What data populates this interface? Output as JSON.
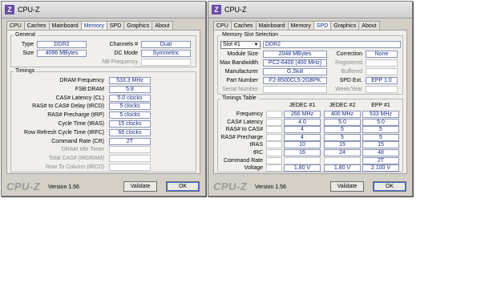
{
  "left": {
    "title": "CPU-Z",
    "tabs": [
      "CPU",
      "Caches",
      "Mainboard",
      "Memory",
      "SPD",
      "Graphics",
      "About"
    ],
    "general": {
      "title": "General",
      "type_label": "Type",
      "type_value": "DDR2",
      "size_label": "Size",
      "size_value": "4096 MBytes",
      "channels_label": "Channels #",
      "channels_value": "Dual",
      "dcmode_label": "DC Mode",
      "dcmode_value": "Symmetric",
      "nbfreq_label": "NB Frequency"
    },
    "timings": {
      "title": "Timings",
      "rows": [
        {
          "label": "DRAM Frequency",
          "value": "533.3 MHz"
        },
        {
          "label": "FSB:DRAM",
          "value": "5:8"
        },
        {
          "label": "CAS# Latency (CL)",
          "value": "5.0 clocks"
        },
        {
          "label": "RAS# to CAS# Delay (tRCD)",
          "value": "5 clocks"
        },
        {
          "label": "RAS# Precharge (tRP)",
          "value": "5 clocks"
        },
        {
          "label": "Cycle Time (tRAS)",
          "value": "15 clocks"
        },
        {
          "label": "Row Refresh Cycle Time (tRFC)",
          "value": "66 clocks"
        },
        {
          "label": "Command Rate (CR)",
          "value": "2T"
        },
        {
          "label": "DRAM Idle Timer",
          "value": ""
        },
        {
          "label": "Total CAS# (tRDRAM)",
          "value": ""
        },
        {
          "label": "Row To Column (tRCD)",
          "value": ""
        }
      ]
    },
    "logo": "CPU-Z",
    "version": "Version 1.56",
    "validate": "Validate",
    "ok": "OK"
  },
  "right": {
    "title": "CPU-Z",
    "tabs": [
      "CPU",
      "Caches",
      "Mainboard",
      "Memory",
      "SPD",
      "Graphics",
      "About"
    ],
    "slot": {
      "title": "Memory Slot Selection",
      "selected": "Slot #1",
      "type": "DDR2",
      "module_size_label": "Module Size",
      "module_size": "2048 MBytes",
      "max_bw_label": "Max Bandwidth",
      "max_bw": "PC2-6400 (400 MHz)",
      "manufacturer_label": "Manufacturer",
      "manufacturer": "G.Skill",
      "part_label": "Part Number",
      "part": "F2-8500CL5-2GBPK",
      "serial_label": "Serial Number",
      "correction_label": "Correction",
      "correction": "None",
      "registered_label": "Registered",
      "buffered_label": "Buffered",
      "spdext_label": "SPD Ext.",
      "spdext": "EPP 1.0",
      "weekyear_label": "Week/Year"
    },
    "table": {
      "title": "Timings Table",
      "headers": [
        "JEDEC #1",
        "JEDEC #2",
        "EPP #1"
      ],
      "rows": [
        {
          "label": "Frequency",
          "v": [
            "266 MHz",
            "400 MHz",
            "533 MHz"
          ]
        },
        {
          "label": "CAS# Latency",
          "v": [
            "4.0",
            "5.0",
            "5.0"
          ]
        },
        {
          "label": "RAS# to CAS#",
          "v": [
            "4",
            "5",
            "5"
          ]
        },
        {
          "label": "RAS# Precharge",
          "v": [
            "4",
            "5",
            "5"
          ]
        },
        {
          "label": "tRAS",
          "v": [
            "10",
            "15",
            "15"
          ]
        },
        {
          "label": "tRC",
          "v": [
            "16",
            "24",
            "48"
          ]
        },
        {
          "label": "Command Rate",
          "v": [
            "",
            "",
            "2T"
          ]
        },
        {
          "label": "Voltage",
          "v": [
            "1.80 V",
            "1.80 V",
            "2.100 V"
          ]
        }
      ]
    },
    "logo": "CPU-Z",
    "version": "Version 1.56",
    "validate": "Validate",
    "ok": "OK"
  }
}
